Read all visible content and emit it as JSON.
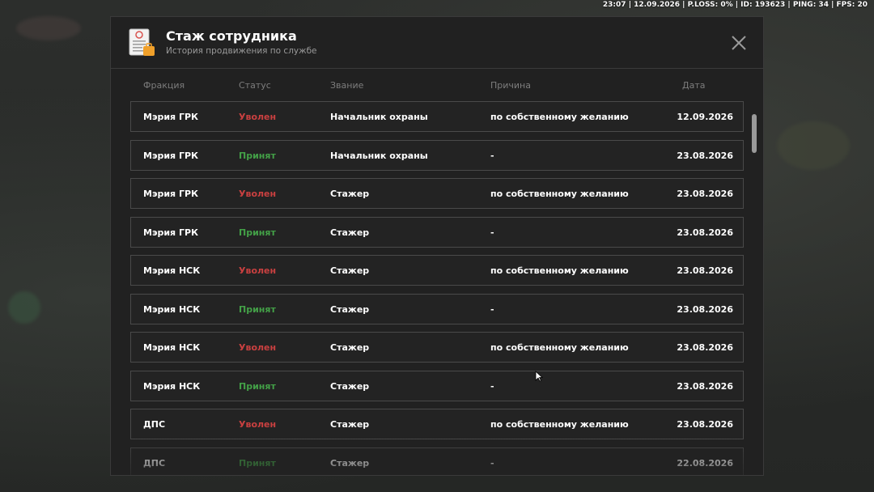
{
  "hud": {
    "text": "23:07 | 12.09.2026 | P.LOSS: 0% | ID: 193623 | PING: 34 | FPS: 20"
  },
  "modal": {
    "title": "Стаж сотрудника",
    "subtitle": "История продвижения по службе",
    "icon": "document-icon",
    "close_icon": "close-icon"
  },
  "columns": {
    "faction": "Фракция",
    "status": "Статус",
    "rank": "Звание",
    "reason": "Причина",
    "date": "Дата"
  },
  "colors": {
    "fired": "#c94040",
    "hired": "#43a047",
    "panel_bg": "#212121",
    "row_border": "#4a4a4a"
  },
  "rows": [
    {
      "faction": "Мэрия ГРК",
      "status": "Уволен",
      "status_type": "fired",
      "rank": "Начальник охраны",
      "reason": "по собственному желанию",
      "date": "12.09.2026"
    },
    {
      "faction": "Мэрия ГРК",
      "status": "Принят",
      "status_type": "hired",
      "rank": "Начальник охраны",
      "reason": "-",
      "date": "23.08.2026"
    },
    {
      "faction": "Мэрия ГРК",
      "status": "Уволен",
      "status_type": "fired",
      "rank": "Стажер",
      "reason": "по собственному желанию",
      "date": "23.08.2026"
    },
    {
      "faction": "Мэрия ГРК",
      "status": "Принят",
      "status_type": "hired",
      "rank": "Стажер",
      "reason": "-",
      "date": "23.08.2026"
    },
    {
      "faction": "Мэрия НСК",
      "status": "Уволен",
      "status_type": "fired",
      "rank": "Стажер",
      "reason": "по собственному желанию",
      "date": "23.08.2026"
    },
    {
      "faction": "Мэрия НСК",
      "status": "Принят",
      "status_type": "hired",
      "rank": "Стажер",
      "reason": "-",
      "date": "23.08.2026"
    },
    {
      "faction": "Мэрия НСК",
      "status": "Уволен",
      "status_type": "fired",
      "rank": "Стажер",
      "reason": "по собственному желанию",
      "date": "23.08.2026"
    },
    {
      "faction": "Мэрия НСК",
      "status": "Принят",
      "status_type": "hired",
      "rank": "Стажер",
      "reason": "-",
      "date": "23.08.2026"
    },
    {
      "faction": "ДПС",
      "status": "Уволен",
      "status_type": "fired",
      "rank": "Стажер",
      "reason": "по собственному желанию",
      "date": "23.08.2026"
    },
    {
      "faction": "ДПС",
      "status": "Принят",
      "status_type": "hired",
      "rank": "Стажер",
      "reason": "-",
      "date": "22.08.2026"
    }
  ]
}
